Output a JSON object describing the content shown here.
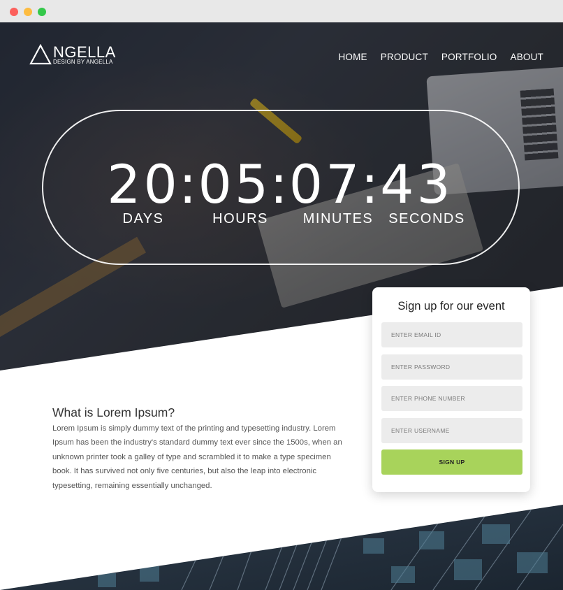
{
  "window": {
    "controls": [
      "close",
      "minimize",
      "maximize"
    ]
  },
  "logo": {
    "name": "NGELLA",
    "tagline": "DESIGN BY ANGELLA",
    "icon": "triangle-icon"
  },
  "nav": {
    "items": [
      "HOME",
      "PRODUCT",
      "PORTFOLIO",
      "ABOUT"
    ]
  },
  "countdown": {
    "days": "20",
    "hours": "05",
    "minutes": "07",
    "seconds": "43",
    "separator": ":",
    "labels": {
      "days": "DAYS",
      "hours": "HOURS",
      "minutes": "MINUTES",
      "seconds": "SECONDS"
    }
  },
  "signup": {
    "title": "Sign up for our event",
    "fields": [
      {
        "placeholder": "ENTER EMAIL ID",
        "value": ""
      },
      {
        "placeholder": "ENTER PASSWORD",
        "value": ""
      },
      {
        "placeholder": "ENTER PHONE NUMBER",
        "value": ""
      },
      {
        "placeholder": "ENTER USERNAME",
        "value": ""
      }
    ],
    "button": "SIGN UP"
  },
  "article": {
    "title": "What is Lorem Ipsum?",
    "body": "Lorem Ipsum is simply dummy text of the printing and typesetting industry. Lorem Ipsum has been the industry's standard dummy text ever since the 1500s, when an unknown printer took a galley of type and scrambled it to make a type specimen book. It has survived not only five centuries, but also the leap into electronic typesetting, remaining essentially unchanged."
  },
  "colors": {
    "accent": "#a8d35b",
    "field_bg": "#ececec",
    "card_bg": "#ffffff"
  }
}
